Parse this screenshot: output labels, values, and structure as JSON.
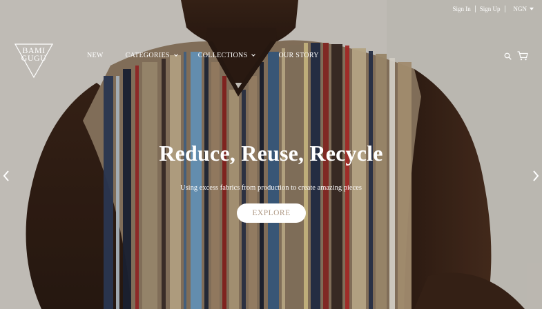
{
  "topbar": {
    "sign_in": "Sign In",
    "sign_up": "Sign Up",
    "currency": "NGN"
  },
  "logo": {
    "line1": "BAMI",
    "line2": "GUGU"
  },
  "nav": {
    "items": [
      {
        "label": "NEW"
      },
      {
        "label": "CATEGORIES"
      },
      {
        "label": "COLLECTIONS"
      },
      {
        "label": "OUR STORY"
      }
    ]
  },
  "icons": {
    "search": "search-icon",
    "cart": "cart-icon",
    "prev": "chevron-left-icon",
    "next": "chevron-right-icon",
    "dropdown": "caret-down-icon"
  },
  "hero": {
    "headline": "Reduce, Reuse, Recycle",
    "subline": "Using excess fabrics from production to create amazing pieces",
    "cta_label": "EXPLORE"
  },
  "colors": {
    "background": "#d6d2cb",
    "cta_text": "#b09a86",
    "text": "#ffffff"
  }
}
